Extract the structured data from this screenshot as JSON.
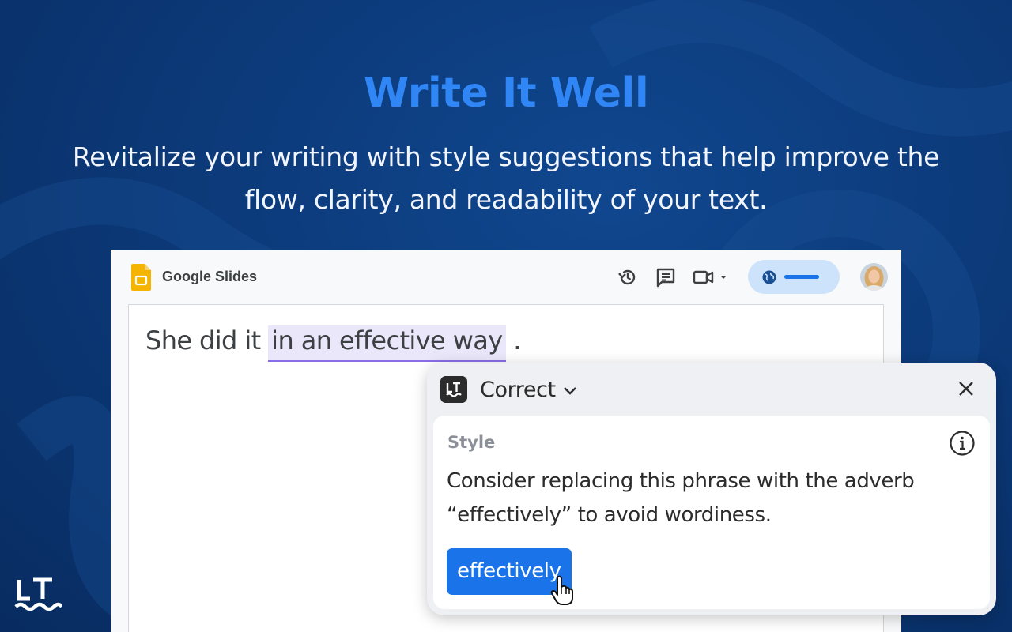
{
  "hero": {
    "title": "Write It Well",
    "subtitle": "Revitalize your writing with style suggestions that help improve the flow, clarity, and readability of your text."
  },
  "app": {
    "name": "Google Slides",
    "toolbar_icons": [
      "version-history-icon",
      "comments-icon",
      "meet-icon",
      "dropdown-caret-icon"
    ],
    "colors": {
      "slides_yellow": "#f4b400",
      "accent_blue": "#1a73e8",
      "pill_bg": "#cce3fb"
    }
  },
  "document": {
    "text_before": "She did it ",
    "highlighted": "in an effective way",
    "text_after": " ."
  },
  "popup": {
    "mode": "Correct",
    "category": "Style",
    "message": "Consider replacing this phrase with the adverb “effectively” to avoid wordiness.",
    "suggestion": "effectively",
    "colors": {
      "highlight_bg": "#ebe7fb",
      "highlight_underline": "#8a6de8"
    }
  }
}
